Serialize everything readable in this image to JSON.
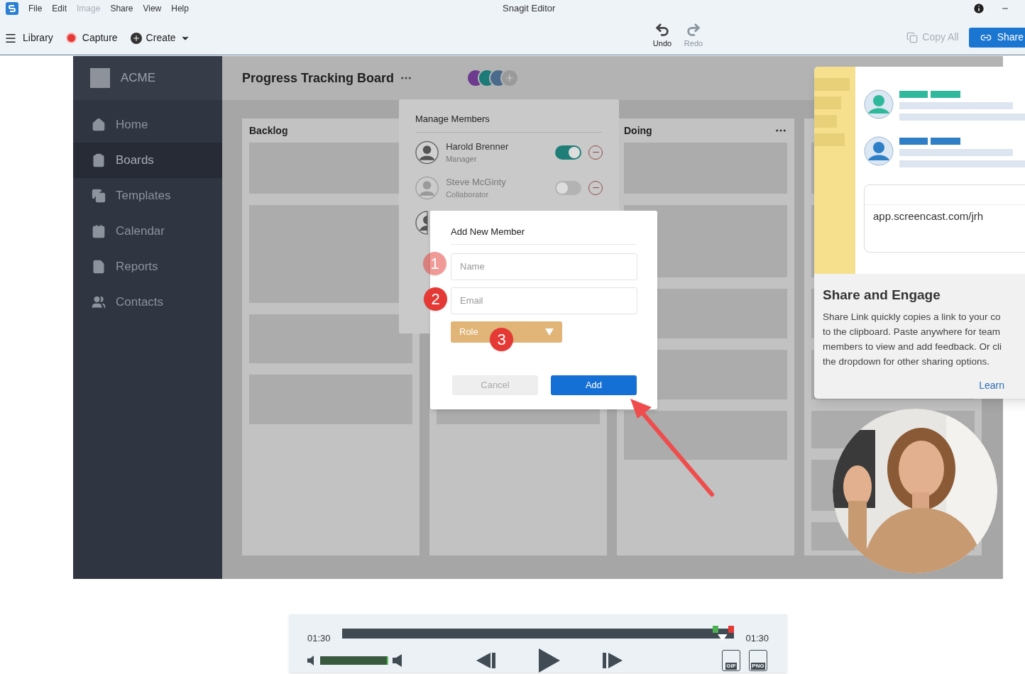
{
  "app": {
    "title": "Snagit Editor",
    "menu": [
      {
        "label": "File",
        "disabled": false
      },
      {
        "label": "Edit",
        "disabled": false
      },
      {
        "label": "Image",
        "disabled": true
      },
      {
        "label": "Share",
        "disabled": false
      },
      {
        "label": "View",
        "disabled": false
      },
      {
        "label": "Help",
        "disabled": false
      }
    ]
  },
  "toolbar": {
    "library": "Library",
    "capture": "Capture",
    "create": "Create",
    "history": [
      {
        "label": "Undo",
        "disabled": false
      },
      {
        "label": "Redo",
        "disabled": true
      }
    ],
    "copy_all": {
      "label": "Copy All",
      "disabled": true
    },
    "share": "Share"
  },
  "recording": {
    "brand": "ACME",
    "nav": [
      {
        "label": "Home",
        "selected": false
      },
      {
        "label": "Boards",
        "selected": true
      },
      {
        "label": "Templates",
        "selected": false
      },
      {
        "label": "Calendar",
        "selected": false
      },
      {
        "label": "Reports",
        "selected": false
      },
      {
        "label": "Contacts",
        "selected": false
      }
    ],
    "board_title": "Progress Tracking Board",
    "columns": [
      {
        "title": "Backlog"
      },
      {},
      {
        "title": "Doing",
        "menu": true
      },
      {}
    ],
    "members_panel": {
      "title": "Manage Members",
      "members": [
        {
          "name": "Harold Brenner",
          "role": "Manager",
          "on": true,
          "disabled": false
        },
        {
          "name": "Steve McGinty",
          "role": "Collaborator",
          "on": false,
          "disabled": true
        }
      ]
    },
    "dialog": {
      "title": "Add New Member",
      "fields": [
        {
          "placeholder": "Name"
        },
        {
          "placeholder": "Email"
        }
      ],
      "role": "Role",
      "buttons": [
        {
          "label": "Cancel",
          "kind": "secondary"
        },
        {
          "label": "Add",
          "kind": "primary"
        }
      ]
    },
    "steps": [
      {
        "label": "1",
        "faded": true
      },
      {
        "label": "2",
        "faded": false
      },
      {
        "label": "3",
        "faded": false
      }
    ]
  },
  "share_panel": {
    "url": "app.screencast.com/jrh",
    "title": "Share and Engage",
    "body_lines": [
      "Share Link quickly copies a link to your co",
      "to the clipboard. Paste anywhere for team",
      "members to view and add feedback. Or cli",
      "the dropdown for other sharing options."
    ],
    "link": "Learn"
  },
  "player": {
    "time_start": "01:30",
    "time_end": "01:30",
    "progress": {
      "level": 0.97
    },
    "volume": {
      "level": 1
    },
    "exports": [
      {
        "label": "GIF"
      },
      {
        "label": "PNG"
      }
    ]
  }
}
